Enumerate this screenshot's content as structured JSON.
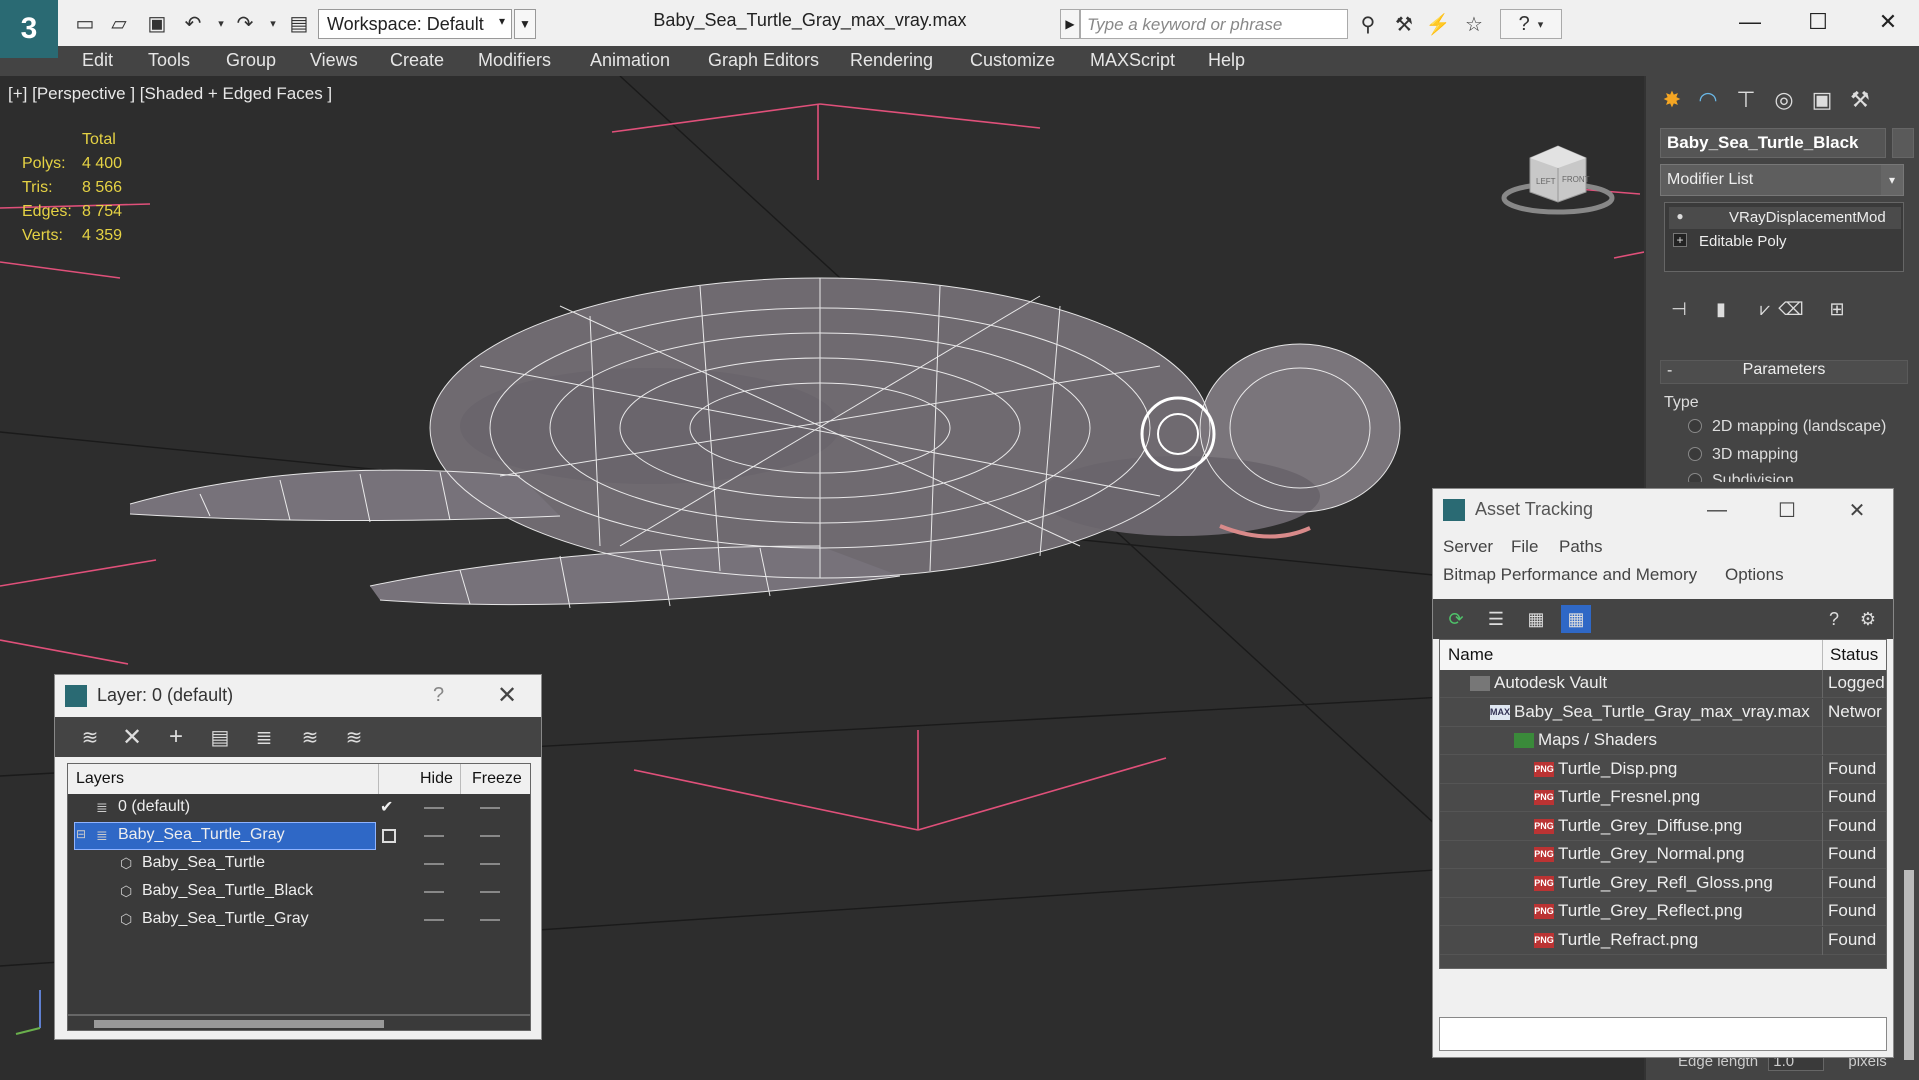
{
  "window": {
    "logo_glyph": "3",
    "workspace_label": "Workspace: Default",
    "doc_title": "Baby_Sea_Turtle_Gray_max_vray.max",
    "search_placeholder": "Type a keyword or phrase",
    "help_glyph": "?",
    "minimize_glyph": "—",
    "maximize_glyph": "☐",
    "close_glyph": "✕"
  },
  "menu": [
    "Edit",
    "Tools",
    "Group",
    "Views",
    "Create",
    "Modifiers",
    "Animation",
    "Graph Editors",
    "Rendering",
    "Customize",
    "MAXScript",
    "Help"
  ],
  "viewport": {
    "label": "[+] [Perspective ] [Shaded + Edged Faces ]",
    "stats": {
      "header": "Total",
      "rows": [
        {
          "k": "Polys:",
          "v": "4 400"
        },
        {
          "k": "Tris:",
          "v": "8 566"
        },
        {
          "k": "Edges:",
          "v": "8 754"
        },
        {
          "k": "Verts:",
          "v": "4 359"
        }
      ]
    },
    "viewcube_left": "LEFT",
    "viewcube_front": "FRONT"
  },
  "command_panel": {
    "object_name": "Baby_Sea_Turtle_Black",
    "modifier_list": "Modifier List",
    "stack": [
      "VRayDisplacementMod",
      "Editable Poly"
    ],
    "params_title": "Parameters",
    "type_label": "Type",
    "radio_options": [
      "2D mapping (landscape)",
      "3D mapping",
      "Subdivision"
    ],
    "edge_length_label": "Edge length",
    "edge_length_value": "1.0",
    "edge_length_unit": "pixels"
  },
  "layer_window": {
    "title": "Layer: 0 (default)",
    "help_glyph": "?",
    "close_glyph": "✕",
    "columns": {
      "layers": "Layers",
      "hide": "Hide",
      "freeze": "Freeze"
    },
    "rows": [
      {
        "name": "0 (default)",
        "indent": 0,
        "selected": false,
        "current": true
      },
      {
        "name": "Baby_Sea_Turtle_Gray",
        "indent": 0,
        "selected": true,
        "current": false
      },
      {
        "name": "Baby_Sea_Turtle",
        "indent": 1,
        "selected": false,
        "current": false
      },
      {
        "name": "Baby_Sea_Turtle_Black",
        "indent": 1,
        "selected": false,
        "current": false
      },
      {
        "name": "Baby_Sea_Turtle_Gray",
        "indent": 1,
        "selected": false,
        "current": false
      }
    ],
    "current_mark": "✔"
  },
  "asset_window": {
    "title": "Asset Tracking",
    "minimize_glyph": "—",
    "maximize_glyph": "☐",
    "close_glyph": "✕",
    "menu_row1": [
      "Server",
      "File",
      "Paths"
    ],
    "menu_row2": [
      "Bitmap Performance and Memory",
      "Options"
    ],
    "columns": {
      "name": "Name",
      "status": "Status"
    },
    "rows": [
      {
        "name": "Autodesk Vault",
        "status": "Logged",
        "level": 0,
        "icon": "vault"
      },
      {
        "name": "Baby_Sea_Turtle_Gray_max_vray.max",
        "status": "Networ",
        "level": 1,
        "icon": "max"
      },
      {
        "name": "Maps / Shaders",
        "status": "",
        "level": 2,
        "icon": "maps"
      },
      {
        "name": "Turtle_Disp.png",
        "status": "Found",
        "level": 3,
        "icon": "png"
      },
      {
        "name": "Turtle_Fresnel.png",
        "status": "Found",
        "level": 3,
        "icon": "png"
      },
      {
        "name": "Turtle_Grey_Diffuse.png",
        "status": "Found",
        "level": 3,
        "icon": "png"
      },
      {
        "name": "Turtle_Grey_Normal.png",
        "status": "Found",
        "level": 3,
        "icon": "png"
      },
      {
        "name": "Turtle_Grey_Refl_Gloss.png",
        "status": "Found",
        "level": 3,
        "icon": "png"
      },
      {
        "name": "Turtle_Grey_Reflect.png",
        "status": "Found",
        "level": 3,
        "icon": "png"
      },
      {
        "name": "Turtle_Refract.png",
        "status": "Found",
        "level": 3,
        "icon": "png"
      }
    ],
    "icon_text": {
      "png": "PNG",
      "max": "MAX",
      "maps": "",
      "vault": ""
    }
  },
  "colors": {
    "stats_yellow": "#e5d244",
    "selection_blue": "#2f68c6",
    "grid_pink": "#e0507a",
    "brand_teal": "#2a6a73"
  }
}
